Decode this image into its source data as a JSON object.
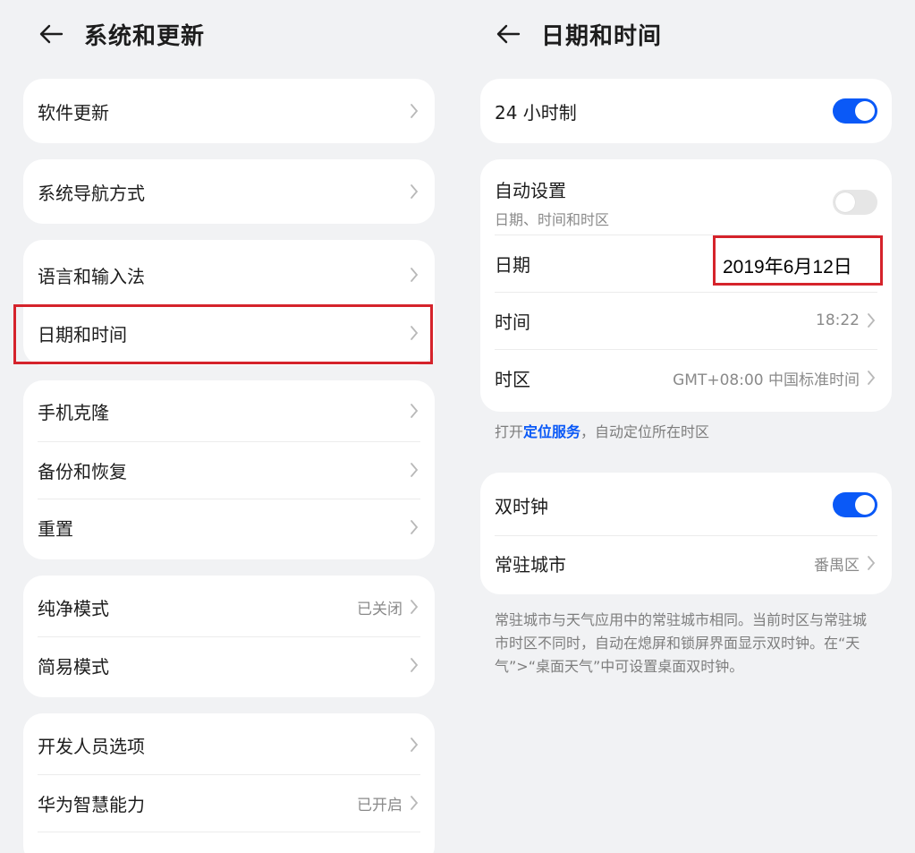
{
  "left": {
    "title": "系统和更新",
    "items": [
      {
        "label": "软件更新"
      },
      {
        "label": "系统导航方式"
      },
      {
        "label": "语言和输入法"
      },
      {
        "label": "日期和时间"
      },
      {
        "label": "手机克隆"
      },
      {
        "label": "备份和恢复"
      },
      {
        "label": "重置"
      },
      {
        "label": "纯净模式",
        "value": "已关闭"
      },
      {
        "label": "简易模式"
      },
      {
        "label": "开发人员选项"
      },
      {
        "label": "华为智慧能力",
        "value": "已开启"
      }
    ]
  },
  "right": {
    "title": "日期和时间",
    "hour24": {
      "label": "24 小时制",
      "on": true
    },
    "auto": {
      "label": "自动设置",
      "sub": "日期、时间和时区",
      "on": false
    },
    "date": {
      "label": "日期",
      "value": "2019年6月12日"
    },
    "time": {
      "label": "时间",
      "value": "18:22"
    },
    "timezone": {
      "label": "时区",
      "value": "GMT+08:00 中国标准时间"
    },
    "location_hint": {
      "prefix": "打开",
      "link": "定位服务",
      "suffix": "，自动定位所在时区"
    },
    "dual_clock": {
      "label": "双时钟",
      "on": true
    },
    "home_city": {
      "label": "常驻城市",
      "value": "番禺区"
    },
    "note": "常驻城市与天气应用中的常驻城市相同。当前时区与常驻城市时区不同时，自动在熄屏和锁屏界面显示双时钟。在“天气”>“桌面天气”中可设置桌面双时钟。"
  },
  "colors": {
    "accent": "#0a59f7",
    "highlight": "#d5232b"
  },
  "icons": {
    "back": "arrow-left-icon",
    "chevron": "chevron-right-icon"
  }
}
